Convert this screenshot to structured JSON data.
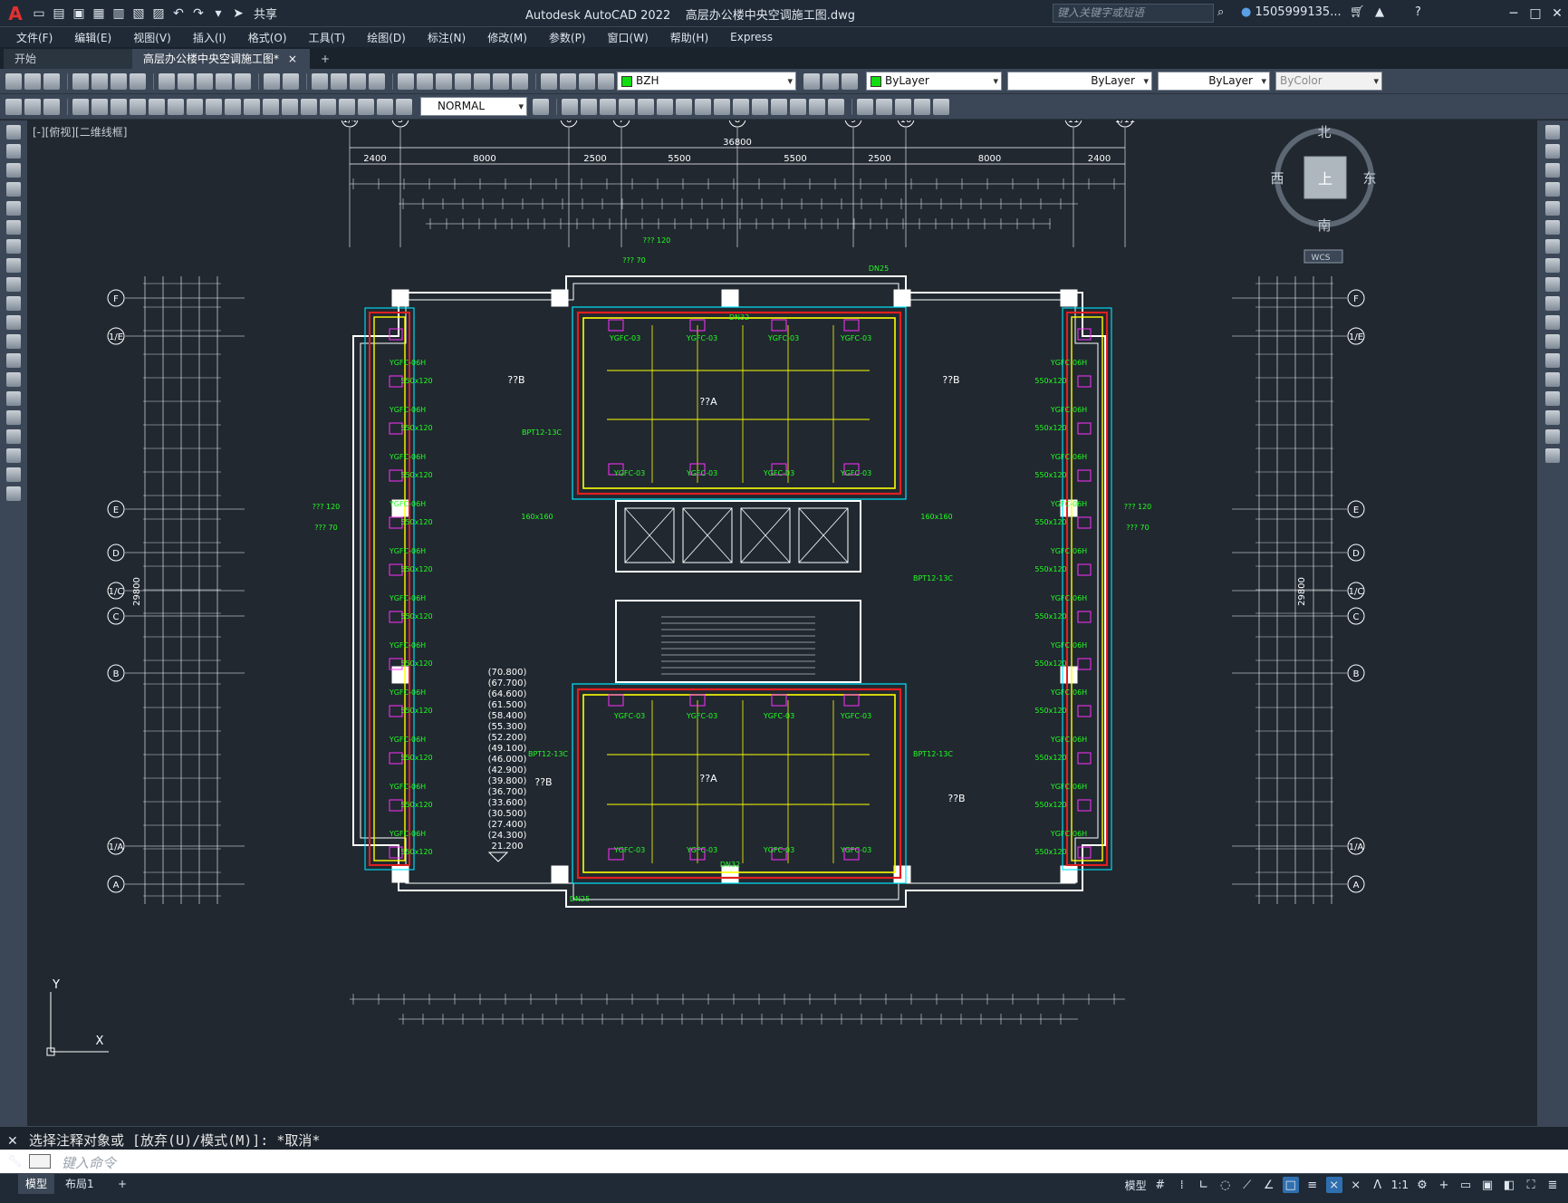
{
  "app": {
    "logo": "A",
    "title": "Autodesk AutoCAD 2022    高层办公楼中央空调施工图.dwg",
    "share_label": "共享",
    "search_placeholder": "键入关键字或短语",
    "user": "1505999135..."
  },
  "menu": [
    "文件(F)",
    "编辑(E)",
    "视图(V)",
    "插入(I)",
    "格式(O)",
    "工具(T)",
    "绘图(D)",
    "标注(N)",
    "修改(M)",
    "参数(P)",
    "窗口(W)",
    "帮助(H)",
    "Express"
  ],
  "tabs": {
    "home": "开始",
    "active": "高层办公楼中央空调施工图*",
    "close": "×",
    "plus": "+"
  },
  "toolbar": {
    "layer": "BZH",
    "color": "ByLayer",
    "linetype": "ByLayer",
    "lineweight": "ByLayer",
    "plotstyle": "ByColor",
    "textstyle": "NORMAL"
  },
  "viewport": {
    "label": "[-][俯视][二维线框]",
    "viewcube": {
      "north": "北",
      "south": "南",
      "east": "东",
      "west": "西",
      "face": "上",
      "wcs": "WCS"
    },
    "ucs": {
      "x": "X",
      "y": "Y"
    }
  },
  "drawing": {
    "col_axes": [
      "1/4",
      "5",
      "6",
      "7",
      "8",
      "9",
      "10",
      "11",
      "1/11"
    ],
    "row_axes": [
      "F",
      "1/E",
      "E",
      "D",
      "1/C",
      "C",
      "B",
      "1/A",
      "A"
    ],
    "overall_width": "36800",
    "overall_height": "29800",
    "top_dims": [
      "2400",
      "8000",
      "2500",
      "5500",
      "5500",
      "2500",
      "8000",
      "2400"
    ],
    "room_labels": [
      "??A",
      "??B",
      "??B",
      "??A",
      "??B",
      "??B"
    ],
    "elevations": [
      "(70.800)",
      "(67.700)",
      "(64.600)",
      "(61.500)",
      "(58.400)",
      "(55.300)",
      "(52.200)",
      "(49.100)",
      "(46.000)",
      "(42.900)",
      "(39.800)",
      "(36.700)",
      "(33.600)",
      "(30.500)",
      "(27.400)",
      "(24.300)",
      "21.200"
    ],
    "equipment_tags": [
      "YGFC-03",
      "YGFC-06H",
      "550x120",
      "BPT12-13C",
      "DN32",
      "DN25",
      "160x160",
      "??? 120",
      "??? 70",
      "NORMAL"
    ]
  },
  "command": {
    "history": "选择注释对象或 [放弃(U)/模式(M)]: *取消*",
    "placeholder": "键入命令"
  },
  "status": {
    "model_tab": "模型",
    "layout_tab": "布局1",
    "add": "+",
    "space": "模型",
    "scale": "1:1"
  },
  "colors": {
    "background": "#212830",
    "wall": "#ffffff",
    "duct_red": "#e02020",
    "duct_yellow": "#ffff00",
    "pipe_cyan": "#00e5ff",
    "text_green": "#22ff22",
    "magenta": "#ff30ff"
  }
}
